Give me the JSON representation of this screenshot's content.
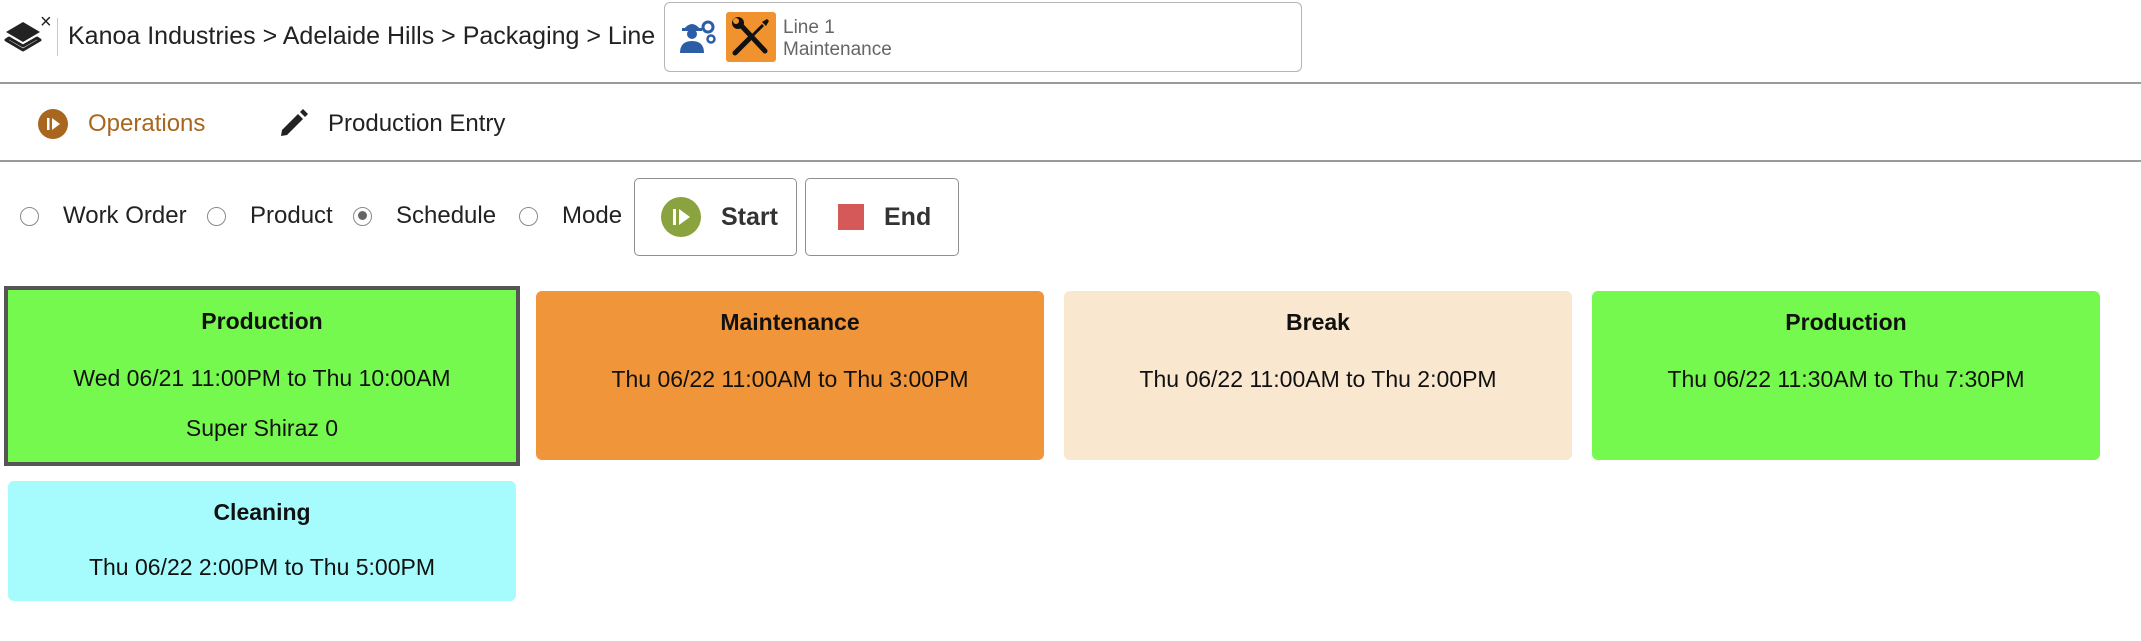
{
  "header": {
    "breadcrumb": "Kanoa Industries > Adelaide Hills > Packaging > Line 1",
    "close_glyph": "×",
    "status": {
      "line": "Line 1",
      "mode": "Maintenance",
      "mode_color": "#f0932f"
    }
  },
  "tabs": [
    {
      "label": "Operations",
      "icon": "play-circle-icon",
      "active": true,
      "color": "#a8661f"
    },
    {
      "label": "Production Entry",
      "icon": "pencil-icon",
      "active": false
    }
  ],
  "filters": [
    {
      "label": "Work Order",
      "checked": false
    },
    {
      "label": "Product",
      "checked": false
    },
    {
      "label": "Schedule",
      "checked": true
    },
    {
      "label": "Mode",
      "checked": false
    }
  ],
  "actions": {
    "start_label": "Start",
    "end_label": "End",
    "start_color": "#8aa33f",
    "end_color": "#d6595a"
  },
  "schedule": [
    {
      "title": "Production",
      "time": "Wed 06/21 11:00PM to Thu 10:00AM",
      "product": "Super Shiraz 0",
      "color": "#76f94e",
      "selected": true
    },
    {
      "title": "Maintenance",
      "time": "Thu 06/22 11:00AM to Thu 3:00PM",
      "product": "",
      "color": "#f0953a",
      "selected": false
    },
    {
      "title": "Break",
      "time": "Thu 06/22 11:00AM to Thu 2:00PM",
      "product": "",
      "color": "#fae7cf",
      "selected": false
    },
    {
      "title": "Production",
      "time": "Thu 06/22 11:30AM to Thu 7:30PM",
      "product": "",
      "color": "#76f94e",
      "selected": false
    },
    {
      "title": "Cleaning",
      "time": "Thu 06/22 2:00PM to Thu 5:00PM",
      "product": "",
      "color": "#a6fcfc",
      "selected": false
    }
  ]
}
